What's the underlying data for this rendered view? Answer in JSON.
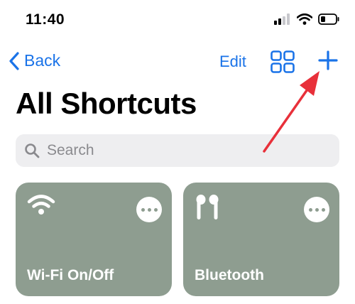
{
  "status_bar": {
    "time": "11:40",
    "icons": [
      "cellular-signal-icon",
      "wifi-icon",
      "battery-icon"
    ]
  },
  "nav": {
    "back_label": "Back",
    "edit_label": "Edit",
    "grid_icon": "grid-view-icon",
    "add_icon": "plus-icon"
  },
  "title": "All Shortcuts",
  "search": {
    "placeholder": "Search",
    "value": ""
  },
  "shortcuts": [
    {
      "label": "Wi-Fi On/Off",
      "icon": "wifi-icon"
    },
    {
      "label": "Bluetooth",
      "icon": "airpods-icon"
    }
  ],
  "annotation": {
    "arrow_color": "#e8303a"
  },
  "colors": {
    "accent": "#1a73e8",
    "tile": "#8e9d90"
  }
}
